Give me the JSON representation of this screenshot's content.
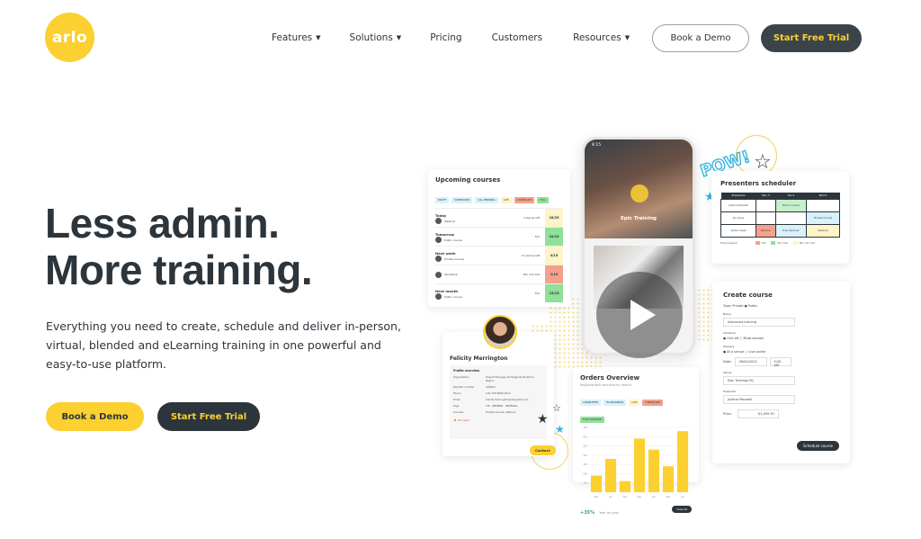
{
  "header": {
    "logo_text": "arlo",
    "nav": [
      {
        "label": "Features",
        "has_dropdown": true
      },
      {
        "label": "Solutions",
        "has_dropdown": true
      },
      {
        "label": "Pricing",
        "has_dropdown": false
      },
      {
        "label": "Customers",
        "has_dropdown": false
      },
      {
        "label": "Resources",
        "has_dropdown": true
      }
    ],
    "book_demo": "Book a Demo",
    "start_trial": "Start Free Trial"
  },
  "hero": {
    "title_line1": "Less admin.",
    "title_line2": "More training.",
    "subtitle": "Everything you need to create, schedule and deliver in-person, virtual, blended and eLearning training in one powerful and easy-to-use platform.",
    "book_demo": "Book a Demo",
    "start_trial": "Start Free Trial"
  },
  "colors": {
    "brand_yellow": "#fbd030",
    "dark": "#2d353c",
    "green": "#8fe09a",
    "red": "#f4a08a",
    "cream": "#fdf4c8",
    "blue": "#38b5e0"
  },
  "upcoming": {
    "title": "Upcoming courses",
    "tags": [
      "DRAFT",
      "SCHEDULED",
      "CAL PENDING",
      "LIVE",
      "CANCELLED",
      "FULL"
    ],
    "groups": [
      {
        "label": "Today",
        "name": "Webinar",
        "places": "7 places left",
        "capacity": "18/25",
        "status": "cream"
      },
      {
        "label": "Tomorrow",
        "name": "Public course",
        "places": "Full",
        "capacity": "10/10",
        "status": "green"
      },
      {
        "label": "Next week",
        "name": "Private Course",
        "places": "11 places left",
        "capacity": "4/15",
        "status": "cream"
      },
      {
        "label": "",
        "name": "Workshop",
        "places": "Min not met",
        "capacity": "1/10",
        "status": "red"
      },
      {
        "label": "Next month",
        "name": "Public course",
        "places": "Full",
        "capacity": "15/15",
        "status": "green"
      }
    ]
  },
  "phone": {
    "time": "8:15",
    "brand": "Epic Training",
    "hero_title": "Epic Training"
  },
  "presenters": {
    "pow": "POW!",
    "title": "Presenters scheduler",
    "columns": [
      "Presenters",
      "Mon 3",
      "Tue 4",
      "Wed 5"
    ],
    "rows": [
      {
        "name": "Justine Maxwell",
        "cells": [
          "",
          "Public Course",
          ""
        ]
      },
      {
        "name": "Joe Jones",
        "cells": [
          "",
          "",
          "Private Course"
        ]
      },
      {
        "name": "Asher Lopez",
        "cells": [
          "Webinar",
          "Free Seminar",
          "Webinar"
        ]
      }
    ],
    "note": "Fully booked!",
    "legend": [
      "Full",
      "Min met",
      "Min not met"
    ]
  },
  "create_course": {
    "title": "Create course",
    "type_label": "Type:",
    "type_options": [
      "Private",
      "Public"
    ],
    "name_label": "Name",
    "name_value": "Advanced training",
    "schedule_label": "Schedule",
    "schedule_options": [
      "One-off",
      "Multi-session"
    ],
    "delivery_label": "Delivery",
    "delivery_options": [
      "At a venue",
      "Live online"
    ],
    "date_label": "Date:",
    "date_value": "06/04/2024",
    "time_value": "9:00 AM",
    "venue_label": "Venue",
    "venue_value": "Epic Training HQ",
    "presenter_label": "Presenter",
    "presenter_value": "Justine Maxwell",
    "price_label": "Price:",
    "price_value": "$1,499.30",
    "button": "Schedule course"
  },
  "orders": {
    "title": "Orders Overview",
    "subtitle": "Registrations received by month",
    "tags": [
      "COMPLETED",
      "IN PROGRESS",
      "LIVE",
      "CANCELLED",
      "FULLY BOOKED"
    ],
    "growth": "+35%",
    "growth_label": "Year on year",
    "view_all": "View all"
  },
  "profile": {
    "name": "Felicity Merrington",
    "section": "Profile overview",
    "fields": [
      {
        "k": "Organization",
        "v": "Project Manager at Designify Northern Region"
      },
      {
        "k": "Member number",
        "v": "AR6401"
      },
      {
        "k": "Phone",
        "v": "120-750-8990 Work"
      },
      {
        "k": "Email",
        "v": "felicity.merrington@designify.com"
      },
      {
        "k": "Tags",
        "v": "VIP · MEMBER · INTERNAL"
      },
      {
        "k": "Courses",
        "v": "Private Course, Webinar"
      }
    ],
    "hot_lead": "Hot lead",
    "contact": "Contact"
  },
  "chart_data": {
    "type": "bar",
    "title": "Orders Overview",
    "subtitle": "Registrations received by month",
    "categories": [
      "Mar",
      "Jan",
      "Feb",
      "Mar",
      "Apr",
      "May",
      "Jun"
    ],
    "values": [
      180,
      360,
      120,
      580,
      460,
      280,
      660
    ],
    "ylim": [
      0,
      700
    ],
    "yticks": [
      100,
      200,
      300,
      400,
      500,
      600,
      700
    ],
    "grid": true,
    "color": "#fbd030"
  }
}
